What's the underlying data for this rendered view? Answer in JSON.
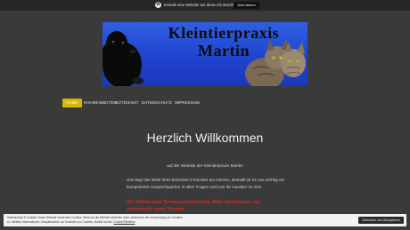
{
  "wp_bar": {
    "text": "Erstelle eine Website wie diese mit WordPress.com",
    "button": "Jetzt starten"
  },
  "banner": {
    "title_line1": "Kleintierpraxis",
    "title_line2": "Martin"
  },
  "nav": {
    "items": [
      "Home",
      "Rahmenbeiten",
      "Notdienst",
      "Datenschutz",
      "Impressum"
    ],
    "active_index": 0,
    "accent_color": "#d9b800"
  },
  "page": {
    "heading": "Herzlich Willkommen",
    "intro": "auf der Website der Kleintierpraxis Martin!",
    "paragraph": "Uns liegt das Wohl Ihres tierischen Freundes am Herzen, deshalb ist es uns wichtig ein kompetenter Ansprechpartner in allen Fragen rund um Ihr Haustier zu sein.",
    "alert": "Wir führen eine Terminsprechstunde. Bitte vereinbaren sie telefonisch einen Termin!",
    "alert_color": "#e32525"
  },
  "cookie": {
    "text": "Datenschutz & Cookies: Diese Website verwendet Cookies. Wenn du die Website weiterhin nutzt, stimmst du der Verwendung von Cookies zu. Weitere Informationen, beispielsweise zur Kontrolle von Cookies, findest du hier:",
    "link": "Cookie-Richtlinie",
    "button": "Schließen und Akzeptieren"
  }
}
